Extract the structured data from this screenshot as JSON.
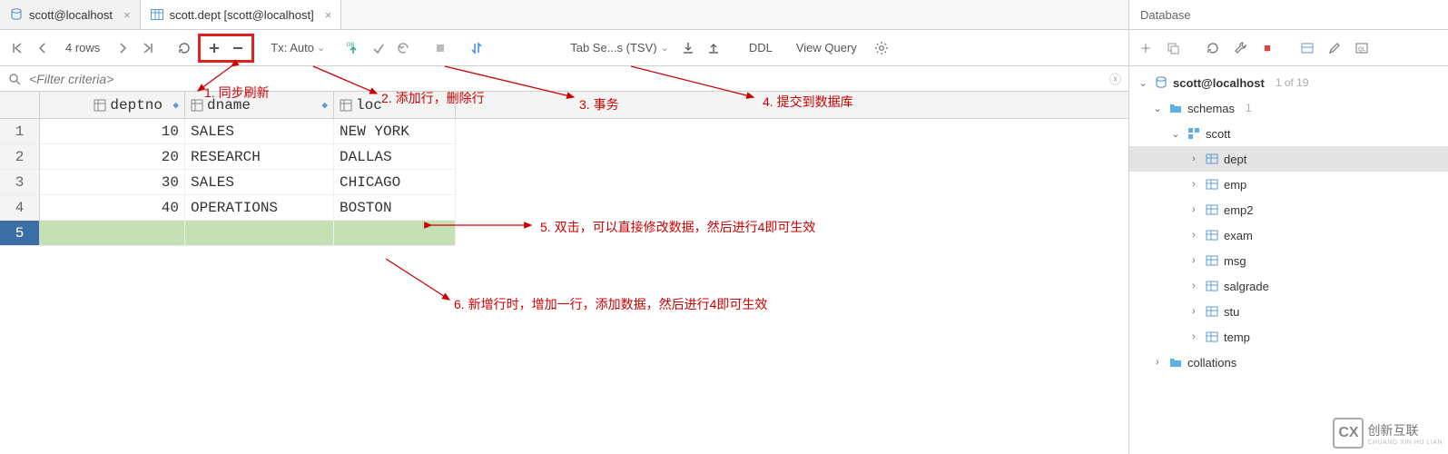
{
  "tabs": [
    {
      "label": "scott@localhost",
      "active": false
    },
    {
      "label": "scott.dept [scott@localhost]",
      "active": true
    }
  ],
  "toolbar": {
    "rows": "4 rows",
    "tx": "Tx: Auto",
    "tab_sep": "Tab Se...s (TSV)",
    "ddl": "DDL",
    "view_query": "View Query"
  },
  "filter_placeholder": "<Filter criteria>",
  "columns": [
    "deptno",
    "dname",
    "loc"
  ],
  "rows": [
    {
      "n": "1",
      "deptno": "10",
      "dname": "SALES",
      "loc": "NEW YORK"
    },
    {
      "n": "2",
      "deptno": "20",
      "dname": "RESEARCH",
      "loc": "DALLAS"
    },
    {
      "n": "3",
      "deptno": "30",
      "dname": "SALES",
      "loc": "CHICAGO"
    },
    {
      "n": "4",
      "deptno": "40",
      "dname": "OPERATIONS",
      "loc": "BOSTON"
    },
    {
      "n": "5",
      "deptno": "<null>",
      "dname": "<null>",
      "loc": "<null>",
      "new": true
    }
  ],
  "annotations": {
    "a1": "1. 同步刷新",
    "a2": "2. 添加行，删除行",
    "a3": "3. 事务",
    "a4": "4. 提交到数据库",
    "a5": "5. 双击，可以直接修改数据，然后进行4即可生效",
    "a6": "6. 新增行时，增加一行，添加数据，然后进行4即可生效"
  },
  "right": {
    "title": "Database",
    "conn": {
      "label": "scott@localhost",
      "meta": "1 of 19"
    },
    "schemas": {
      "label": "schemas",
      "meta": "1"
    },
    "schema": "scott",
    "tables": [
      "dept",
      "emp",
      "emp2",
      "exam",
      "msg",
      "salgrade",
      "stu",
      "temp"
    ],
    "collations": "collations"
  },
  "watermark": {
    "brand": "创新互联",
    "sub": "CHUANG XIN HU LIAN"
  }
}
